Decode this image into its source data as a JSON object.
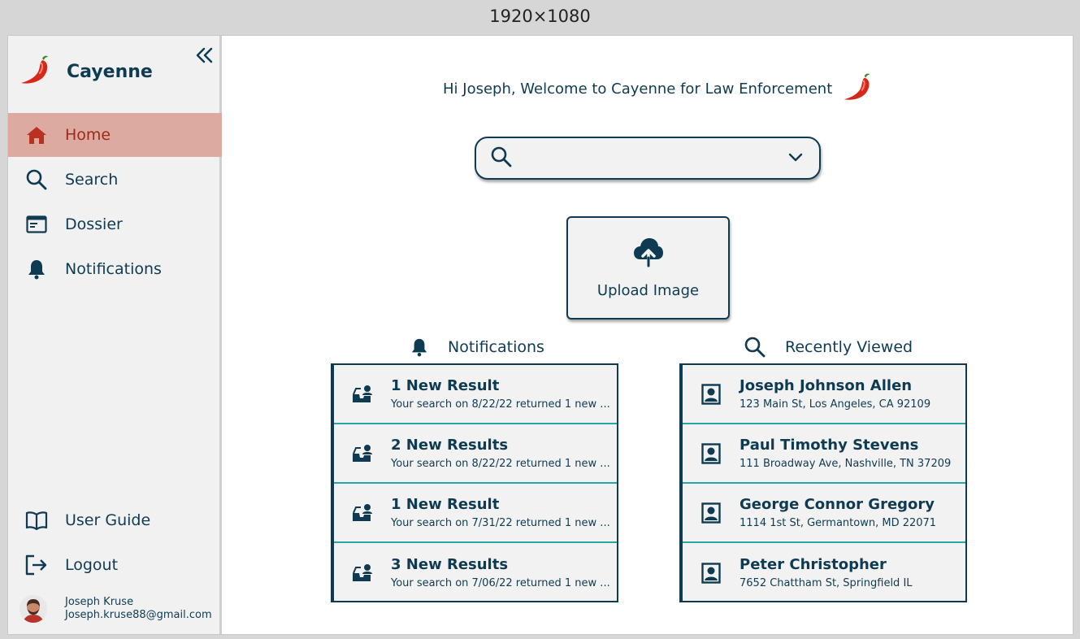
{
  "frame": {
    "label": "1920×1080"
  },
  "sidebar": {
    "brand": "Cayenne",
    "collapse_icon": "double-chevron-left-icon",
    "nav": [
      {
        "label": "Home",
        "icon": "home-icon",
        "active": true
      },
      {
        "label": "Search",
        "icon": "search-icon",
        "active": false
      },
      {
        "label": "Dossier",
        "icon": "dossier-icon",
        "active": false
      },
      {
        "label": "Notifications",
        "icon": "bell-icon",
        "active": false
      }
    ],
    "bottom_nav": [
      {
        "label": "User Guide",
        "icon": "book-icon"
      },
      {
        "label": "Logout",
        "icon": "logout-icon"
      }
    ],
    "user": {
      "name": "Joseph Kruse",
      "email": "Joseph.kruse88@gmail.com"
    }
  },
  "main": {
    "welcome": "Hi Joseph, Welcome to Cayenne for Law Enforcement",
    "search": {
      "placeholder": ""
    },
    "upload_label": "Upload Image",
    "notifications": {
      "heading": "Notifications",
      "items": [
        {
          "title": "1 New Result",
          "subtitle": "Your search on 8/22/22 returned 1 new ..."
        },
        {
          "title": "2 New Results",
          "subtitle": "Your search on 8/22/22 returned 1 new ..."
        },
        {
          "title": "1 New Result",
          "subtitle": "Your search on 7/31/22 returned 1 new ..."
        },
        {
          "title": "3 New Results",
          "subtitle": "Your search on 7/06/22 returned 1 new ..."
        }
      ]
    },
    "recent": {
      "heading": "Recently Viewed",
      "items": [
        {
          "title": "Joseph Johnson Allen",
          "subtitle": "123 Main St, Los Angeles, CA 92109"
        },
        {
          "title": "Paul Timothy Stevens",
          "subtitle": "111 Broadway Ave, Nashville, TN 37209"
        },
        {
          "title": "George Connor Gregory",
          "subtitle": "1114 1st St, Germantown, MD 22071"
        },
        {
          "title": "Peter Christopher",
          "subtitle": "7652 Chattham St, Springfield IL"
        }
      ]
    }
  },
  "colors": {
    "primary": "#0f3b52",
    "active_bg": "#dcaaa1",
    "active_text": "#9c2a1a",
    "divider": "#2aa6a1",
    "pepper_red": "#d62718"
  }
}
